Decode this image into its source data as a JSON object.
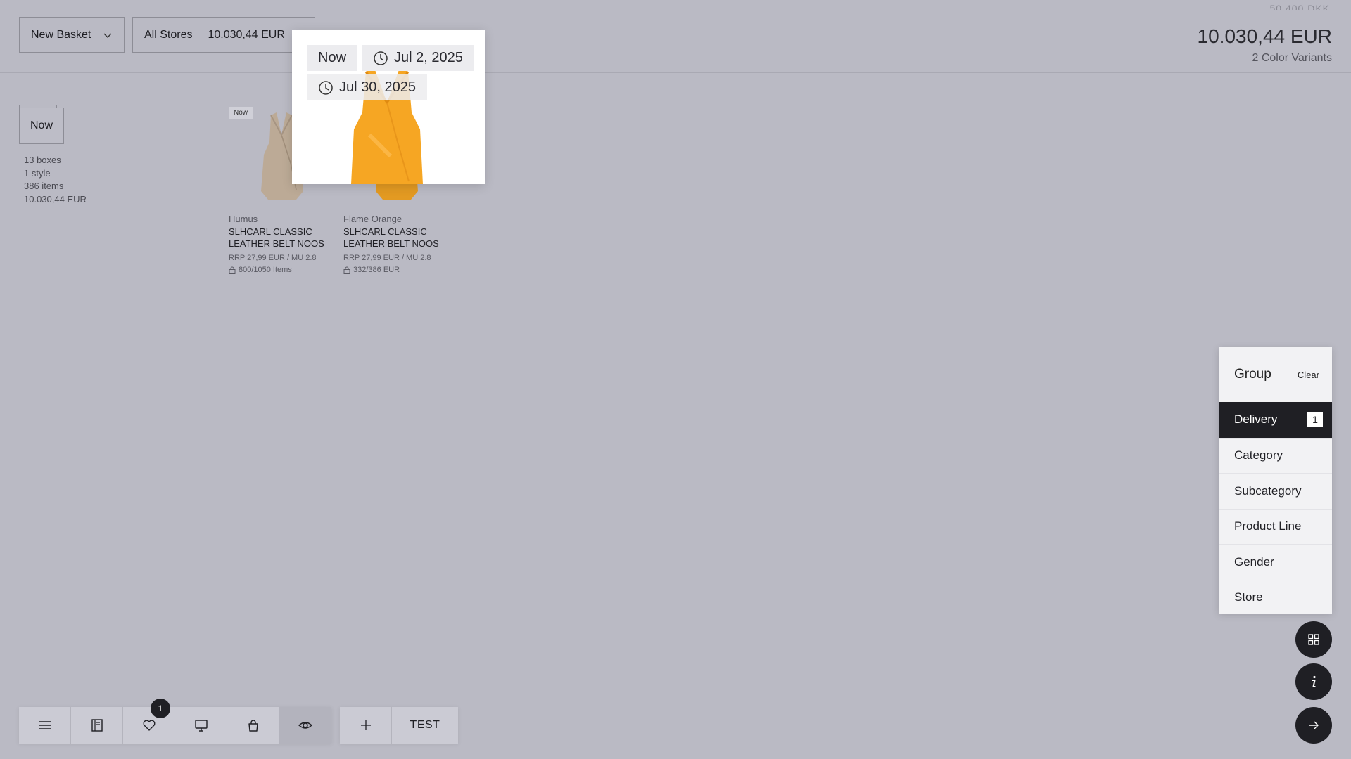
{
  "header": {
    "basket_label": "New Basket",
    "stores_label": "All Stores",
    "stores_amount": "10.030,44 EUR",
    "faded_top": "50.400 DKK",
    "total": "10.030,44 EUR",
    "variants": "2 Color Variants"
  },
  "summary": {
    "now_tag": "Now",
    "boxes": "13 boxes",
    "styles": "1 style",
    "items": "386 items",
    "amount": "10.030,44 EUR"
  },
  "products": [
    {
      "badge": "Now",
      "color": "Humus",
      "name_line1": "SLHCARL CLASSIC",
      "name_line2": "LEATHER BELT NOOS",
      "price": "RRP 27,99 EUR / MU 2.8",
      "stock": "800/1050 Items",
      "garment_color": "#bcaa96"
    },
    {
      "color": "Flame Orange",
      "name_line1": "SLHCARL CLASSIC",
      "name_line2": "LEATHER BELT NOOS",
      "price": "RRP 27,99 EUR / MU 2.8",
      "stock": "332/386 EUR",
      "garment_color": "#f4a62a"
    }
  ],
  "popover": {
    "chip_now": "Now",
    "chip_date1": "Jul 2, 2025",
    "chip_date2": "Jul 30, 2025"
  },
  "group_panel": {
    "title": "Group",
    "clear": "Clear",
    "items": [
      {
        "label": "Delivery",
        "count": "1",
        "active": true
      },
      {
        "label": "Category"
      },
      {
        "label": "Subcategory"
      },
      {
        "label": "Product Line"
      },
      {
        "label": "Gender"
      },
      {
        "label": "Store"
      }
    ]
  },
  "fabs": [
    "grid-icon",
    "info-icon",
    "arrow-right-icon"
  ],
  "toolbar": {
    "wishlist_badge": "1",
    "test_label": "TEST",
    "icons": [
      "menu-icon",
      "catalog-icon",
      "heart-icon",
      "monitor-icon",
      "bag-icon",
      "eye-icon",
      "plus-icon"
    ]
  },
  "colors": {
    "background": "#babac4",
    "dark": "#1f1f24",
    "panel": "#f2f2f4"
  }
}
